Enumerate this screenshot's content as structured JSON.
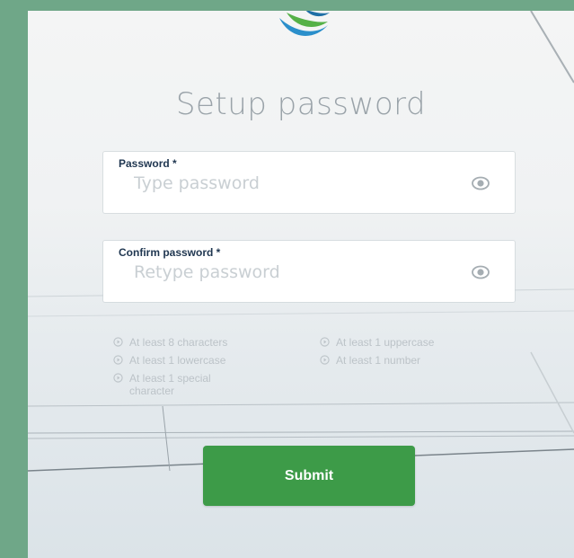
{
  "page": {
    "title": "Setup password"
  },
  "form": {
    "password": {
      "label": "Password *",
      "placeholder": "Type password",
      "icon": "eye-icon"
    },
    "confirm": {
      "label": "Confirm password *",
      "placeholder": "Retype password",
      "icon": "eye-icon"
    },
    "rules": [
      "At least 8 characters",
      "At least 1 uppercase",
      "At least 1 lowercase",
      "At least 1 number",
      "At least 1 special character"
    ],
    "submit_label": "Submit"
  },
  "colors": {
    "frame": "#6fa788",
    "submit": "#3d9b48",
    "label": "#1f3650",
    "title": "#9aa3a9"
  }
}
